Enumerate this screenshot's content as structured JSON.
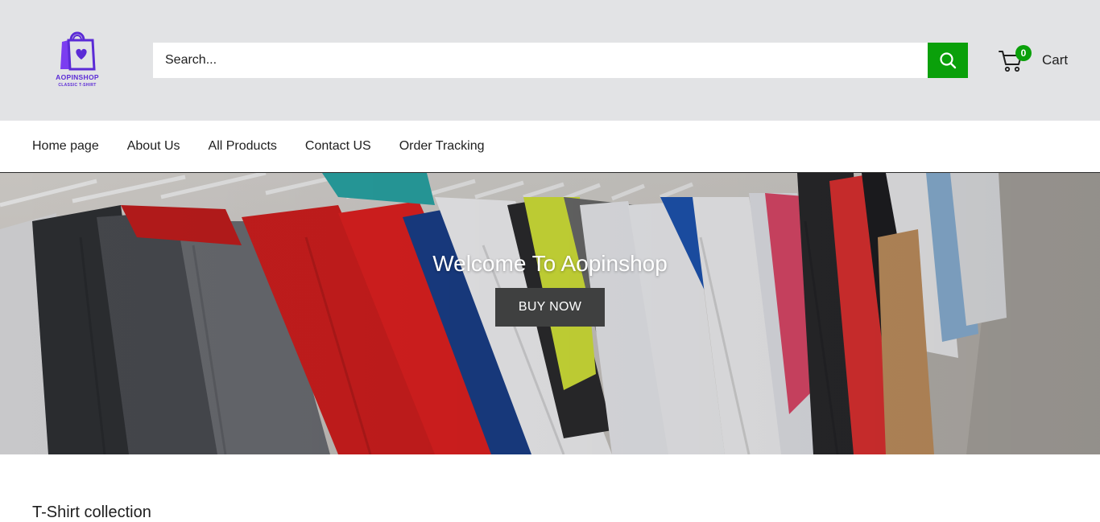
{
  "brand": {
    "name": "AOPINSHOP",
    "tagline": "CLASSIC T-SHIRT",
    "color": "#5b2bd6"
  },
  "search": {
    "placeholder": "Search...",
    "button_color": "#0aa00a"
  },
  "cart": {
    "count": "0",
    "label": "Cart"
  },
  "nav": {
    "items": [
      {
        "label": "Home page"
      },
      {
        "label": "About Us"
      },
      {
        "label": "All Products"
      },
      {
        "label": "Contact US"
      },
      {
        "label": "Order Tracking"
      }
    ]
  },
  "hero": {
    "title": "Welcome To Aopinshop",
    "button_label": "BUY NOW"
  },
  "section": {
    "title": "T-Shirt collection"
  },
  "icons": [
    "shopping-bag-logo-icon",
    "search-icon",
    "cart-icon"
  ]
}
